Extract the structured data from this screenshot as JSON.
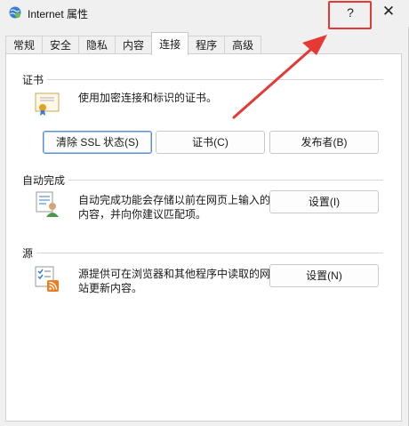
{
  "window": {
    "title": "Internet 属性",
    "help_label": "?",
    "close_label": "✕",
    "icon": "internet-globe-icon"
  },
  "tabs": [
    {
      "label": "常规"
    },
    {
      "label": "安全"
    },
    {
      "label": "隐私"
    },
    {
      "label": "内容"
    },
    {
      "label": "连接"
    },
    {
      "label": "程序"
    },
    {
      "label": "高级"
    }
  ],
  "active_tab": "连接",
  "certificates": {
    "heading": "证书",
    "description": "使用加密连接和标识的证书。",
    "icon": "certificate-icon",
    "buttons": {
      "clear_ssl": "清除 SSL 状态(S)",
      "certificates": "证书(C)",
      "publishers": "发布者(B)"
    }
  },
  "autocomplete": {
    "heading": "自动完成",
    "description_line1": "自动完成功能会存储以前在网页上输入的",
    "description_line2": "内容，并向你建议匹配项。",
    "icon": "autocomplete-user-icon",
    "settings_button": "设置(I)"
  },
  "feeds": {
    "heading": "源",
    "description_line1": "源提供可在浏览器和其他程序中读取的网",
    "description_line2": "站更新内容。",
    "icon": "feeds-rss-icon",
    "settings_button": "设置(N)"
  },
  "colors": {
    "highlight": "#e53935",
    "focus_border": "#5a8fd0",
    "window_bg": "#f0f0f0",
    "panel_bg": "#ffffff"
  }
}
